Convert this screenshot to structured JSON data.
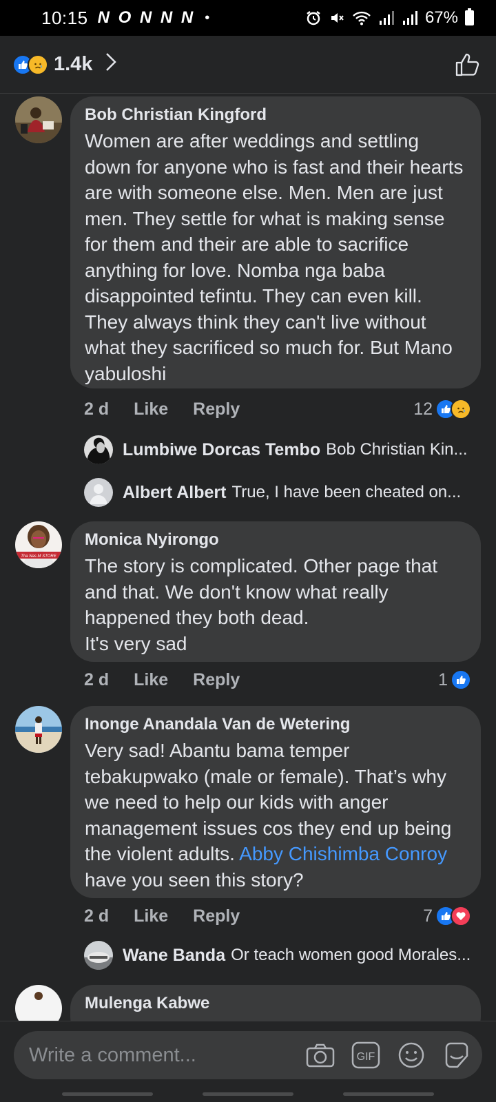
{
  "status_bar": {
    "time": "10:15",
    "notification_icons": "N O N N N",
    "dot": "•",
    "battery": "67%"
  },
  "header": {
    "reactions": [
      "like",
      "sad"
    ],
    "count": "1.4k"
  },
  "comments": [
    {
      "author": "Bob Christian Kingford",
      "text": "Women are after weddings and settling down for anyone who is fast and their hearts are with someone else. Men. Men are just men. They settle for what is making sense for them and their are able to sacrifice anything for love. Nomba nga baba disappointed tefintu. They can even kill. They always think they can't live without what they sacrificed so much for. But Mano yabuloshi",
      "time": "2 d",
      "like_label": "Like",
      "reply_label": "Reply",
      "reaction_count": "12",
      "reactions": [
        "like",
        "sad"
      ],
      "replies": [
        {
          "author": "Lumbiwe Dorcas Tembo",
          "text": "Bob Christian Kin..."
        },
        {
          "author": "Albert Albert",
          "text": "True,  I have been cheated on..."
        }
      ]
    },
    {
      "author": "Monica Nyirongo",
      "text_lines": [
        "The story is complicated. Other page that and that. We don't know what really happened they both dead.",
        "It's very sad"
      ],
      "time": "2 d",
      "like_label": "Like",
      "reply_label": "Reply",
      "reaction_count": "1",
      "reactions": [
        "like"
      ],
      "avatar_text": "Tha Nas M STORE"
    },
    {
      "author": "Inonge Anandala Van de Wetering",
      "text_before": "Very sad! Abantu bama temper tebakupwako (male or female). That’s why we need to help our kids with anger management issues cos they end up being the violent adults.",
      "mention": "Abby Chishimba Conroy",
      "text_after": "have you seen this story?",
      "time": "2 d",
      "like_label": "Like",
      "reply_label": "Reply",
      "reaction_count": "7",
      "reactions": [
        "like",
        "love"
      ],
      "replies": [
        {
          "author": "Wane Banda",
          "text": "Or teach women good Morales..."
        }
      ]
    },
    {
      "author": "Mulenga Kabwe"
    }
  ],
  "composer": {
    "placeholder": "Write a comment...",
    "icons": [
      "camera-icon",
      "gif-icon",
      "emoji-icon",
      "sticker-icon"
    ],
    "gif_label": "GIF"
  },
  "colors": {
    "background": "#242526",
    "bubble": "#3a3b3c",
    "accent": "#1877f2",
    "mention": "#4599ff",
    "secondary_text": "#b0b3b8"
  }
}
